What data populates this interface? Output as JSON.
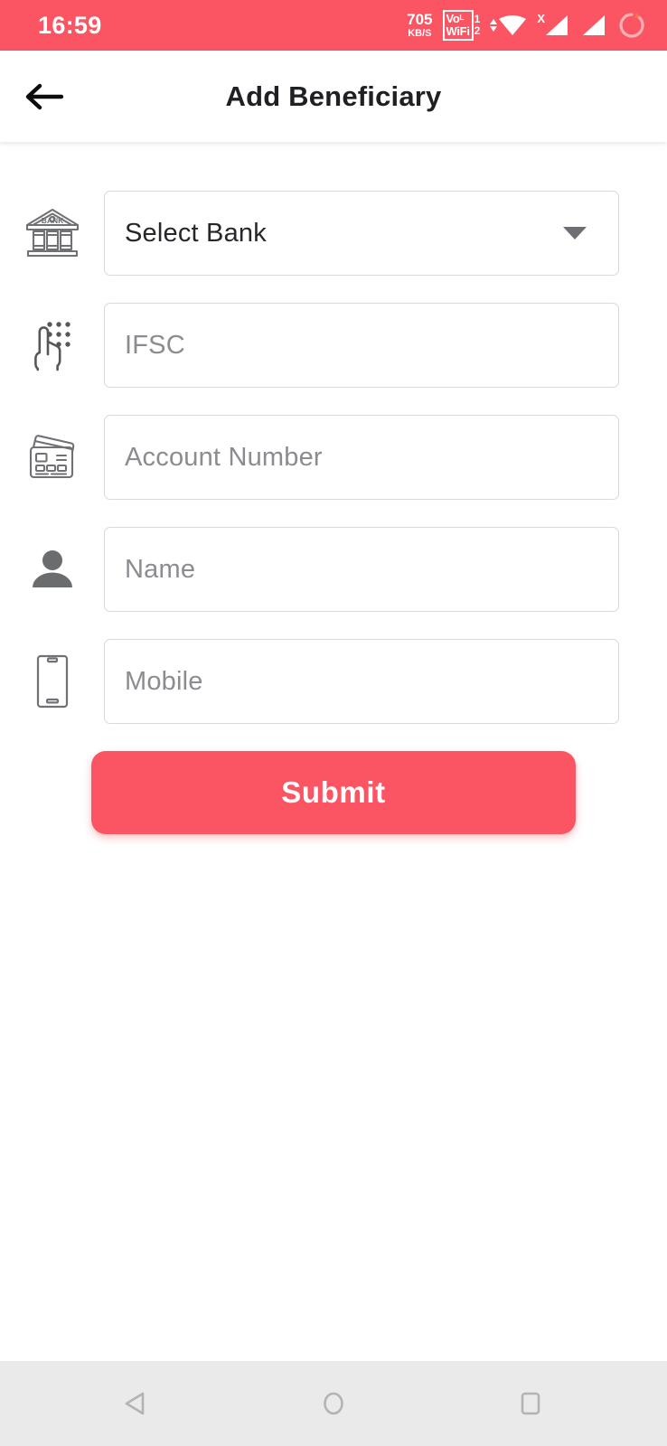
{
  "status_bar": {
    "time": "16:59",
    "data_speed_value": "705",
    "data_speed_unit": "KB/S",
    "vowifi_line1": "Voᴸ",
    "vowifi_line2": "WiFi",
    "vowifi_sim1": "1",
    "vowifi_sim2": "2",
    "signal_x": "X",
    "icons": [
      "data-speed-indicator",
      "vowifi-badge",
      "wifi-icon",
      "signal-bars-sim1-icon",
      "signal-bars-sim2-icon",
      "sync-circle-icon"
    ],
    "background_color": "#fb5462",
    "foreground_color": "#ffffff"
  },
  "header": {
    "title": "Add Beneficiary",
    "back_icon": "arrow-left-icon"
  },
  "form": {
    "fields": [
      {
        "name": "select-bank",
        "icon": "bank-building-icon",
        "value": "Select Bank",
        "placeholder": "Select Bank",
        "type": "dropdown",
        "filled": true
      },
      {
        "name": "ifsc",
        "icon": "pin-keypad-hand-icon",
        "value": "",
        "placeholder": "IFSC",
        "type": "text",
        "filled": false
      },
      {
        "name": "account-number",
        "icon": "credit-cards-icon",
        "value": "",
        "placeholder": "Account Number",
        "type": "text",
        "filled": false
      },
      {
        "name": "name",
        "icon": "person-icon",
        "value": "",
        "placeholder": "Name",
        "type": "text",
        "filled": false
      },
      {
        "name": "mobile",
        "icon": "smartphone-icon",
        "value": "",
        "placeholder": "Mobile",
        "type": "tel",
        "filled": false
      }
    ],
    "submit_label": "Submit",
    "accent_color": "#fb5462"
  },
  "nav_bar": {
    "back_label": "back-triangle-icon",
    "home_label": "home-circle-icon",
    "recents_label": "recents-square-icon",
    "background_color": "#eaeaea"
  }
}
